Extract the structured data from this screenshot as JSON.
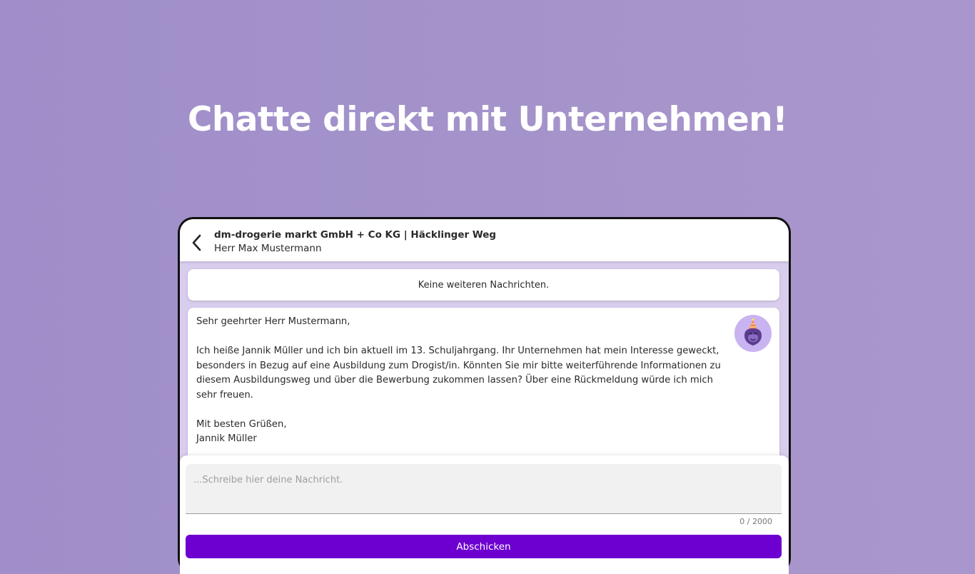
{
  "headline": "Chatte direkt mit Unternehmen!",
  "colors": {
    "background": "#a493ca",
    "accent": "#6d00d1",
    "avatar_bg": "#c9b3f0",
    "chat_bg": "#d9cdee"
  },
  "chat": {
    "header": {
      "back_icon": "chevron-left-icon",
      "title": "dm-drogerie markt GmbH + Co KG | Häcklinger Weg",
      "subtitle": "Herr Max Mustermann"
    },
    "no_more_messages": "Keine weiteren Nachrichten.",
    "message": {
      "greeting": "Sehr geehrter Herr Mustermann,",
      "body": "Ich heiße Jannik Müller und ich bin aktuell im 13. Schuljahrgang. Ihr Unternehmen hat mein Interesse geweckt, besonders in Bezug auf eine Ausbildung zum Drogist/in. Könnten Sie mir bitte weiterführende Informationen zu diesem Ausbildungsweg und über die Bewerbung zukommen lassen? Über eine Rückmeldung würde ich mich sehr freuen.",
      "closing": "Mit besten Grüßen,",
      "signature": "Jannik Müller",
      "avatar_icon": "party-mascot-icon"
    },
    "composer": {
      "placeholder": "...Schreibe hier deine Nachricht.",
      "value": "",
      "counter": "0 / 2000",
      "submit_label": "Abschicken"
    }
  }
}
